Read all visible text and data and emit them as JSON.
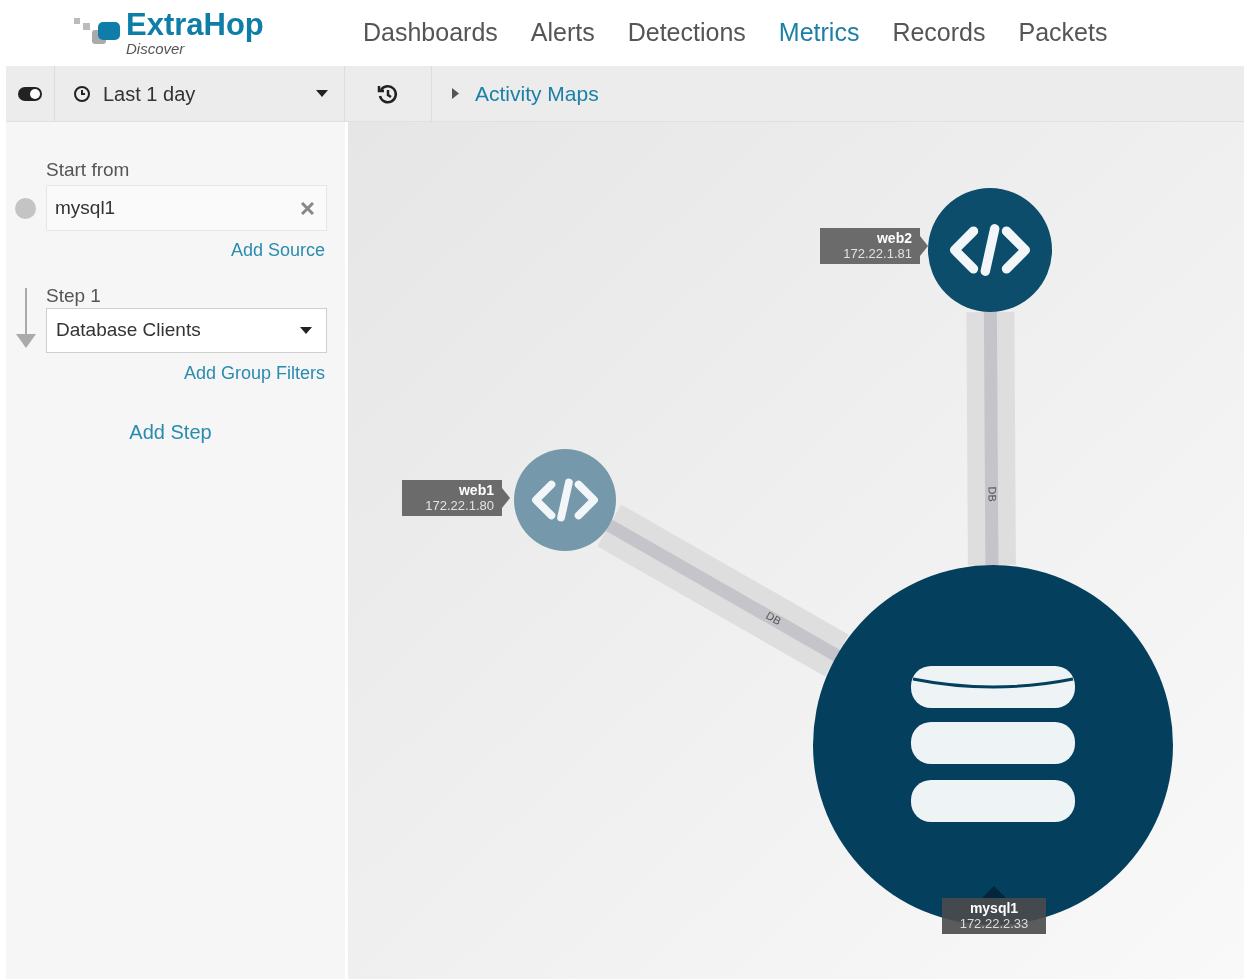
{
  "header": {
    "logo": "ExtraHop",
    "logo_sub": "Discover",
    "nav": [
      {
        "label": "Dashboards",
        "selected": false
      },
      {
        "label": "Alerts",
        "selected": false
      },
      {
        "label": "Detections",
        "selected": false
      },
      {
        "label": "Metrics",
        "selected": true
      },
      {
        "label": "Records",
        "selected": false
      },
      {
        "label": "Packets",
        "selected": false
      }
    ]
  },
  "toolbar": {
    "time_range": "Last 1 day",
    "breadcrumb": "Activity Maps"
  },
  "sidebar": {
    "start_label": "Start from",
    "source_value": "mysql1",
    "add_source": "Add Source",
    "steps": [
      {
        "label": "Step 1",
        "value": "Database Clients",
        "add_filters": "Add Group Filters"
      }
    ],
    "add_step": "Add Step"
  },
  "map": {
    "nodes": [
      {
        "kind": "server",
        "name": "web1",
        "ip": "172.22.1.80",
        "color": "#7599ab",
        "link_label": "DB"
      },
      {
        "kind": "server",
        "name": "web2",
        "ip": "172.22.1.81",
        "color": "#0b4d6b",
        "link_label": "DB"
      },
      {
        "kind": "database",
        "name": "mysql1",
        "ip": "172.22.2.33",
        "color": "#053f5e"
      }
    ]
  }
}
